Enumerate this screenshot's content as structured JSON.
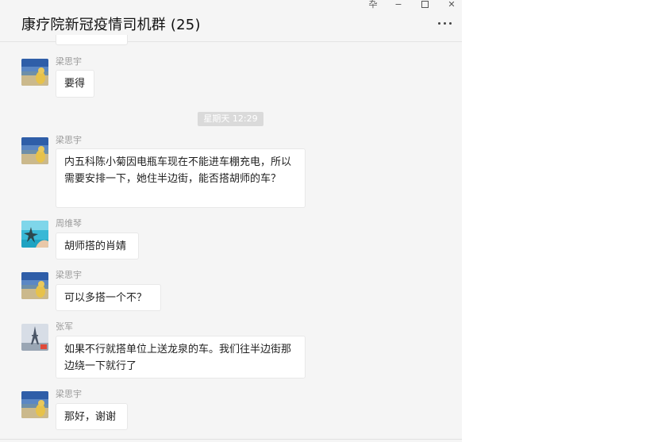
{
  "window": {
    "title": "康疗院新冠疫情司机群 (25)",
    "controls": {
      "pin": "卆",
      "minimize": "−",
      "close": "✕"
    }
  },
  "timestamp_divider": "星期天 12:29",
  "messages": [
    {
      "sender": "梁思宇",
      "text": "要得",
      "avatar": "beach-dog-avatar"
    },
    {
      "sender": "梁思宇",
      "text": "内五科陈小菊因电瓶车现在不能进车棚充电，所以需要安排一下，她住半边街，能否搭胡师的车？",
      "avatar": "beach-dog-avatar"
    },
    {
      "sender": "周维琴",
      "text": "胡师搭的肖婧",
      "avatar": "starfish-sea-avatar"
    },
    {
      "sender": "梁思宇",
      "text": "可以多搭一个不？",
      "avatar": "beach-dog-avatar"
    },
    {
      "sender": "张军",
      "text": "如果不行就搭单位上送龙泉的车。我们往半边街那边绕一下就行了",
      "avatar": "eiffel-tower-avatar"
    },
    {
      "sender": "梁思宇",
      "text": "那好，谢谢",
      "avatar": "beach-dog-avatar"
    }
  ]
}
